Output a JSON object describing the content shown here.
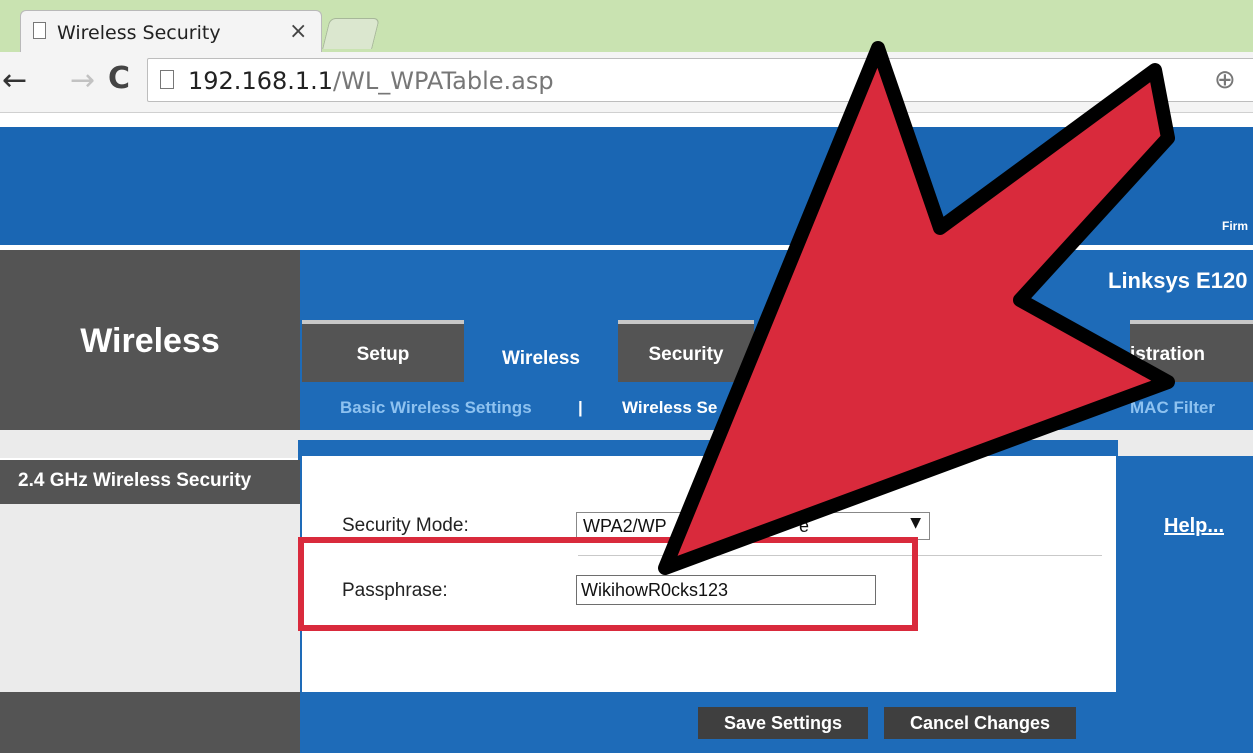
{
  "browser": {
    "tab_title": "Wireless Security",
    "tab_close": "×",
    "url_host": "192.168.1.1",
    "url_path": "/WL_WPATable.asp"
  },
  "router": {
    "firmware_label": "Firm",
    "section_title": "Wireless",
    "model_name": "Linksys E120",
    "nav_tabs": [
      {
        "label": "Setup"
      },
      {
        "label": "Wireless"
      },
      {
        "label": "Security"
      },
      {
        "label": "istration"
      }
    ],
    "subnav": [
      {
        "label": "Basic Wireless Settings"
      },
      {
        "label": "|"
      },
      {
        "label": "Wireless Se"
      },
      {
        "label": "MAC Filter"
      }
    ],
    "security_label": "2.4 GHz Wireless Security",
    "help_link": "Help...",
    "security_mode_label": "Security Mode:",
    "security_mode_value": "WPA2/WP",
    "security_mode_value_tail": "e",
    "passphrase_label": "Passphrase:",
    "passphrase_value": "WikihowR0cks123",
    "save_button": "Save Settings",
    "cancel_button": "Cancel Changes"
  },
  "overlay": {
    "arrow_color": "#d92a3c",
    "highlight_color": "#d92a3c"
  }
}
